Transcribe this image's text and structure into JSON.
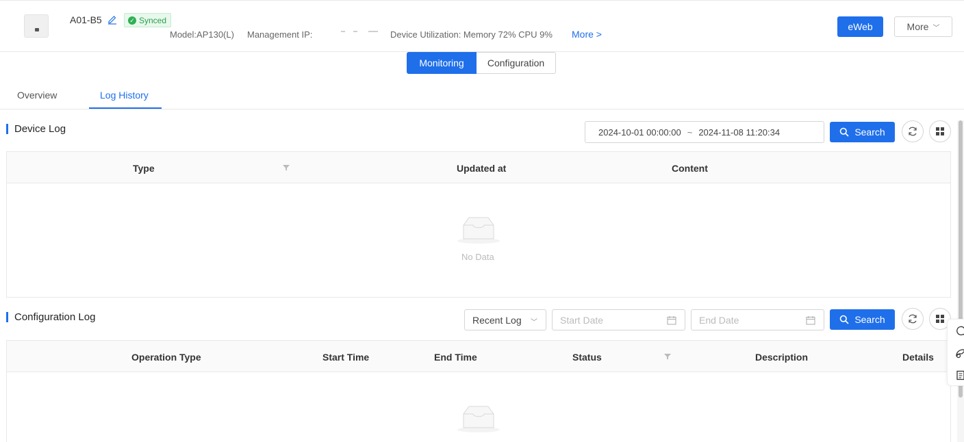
{
  "device": {
    "name": "A01-B5",
    "status": "Synced",
    "model": "Model:AP130(L)",
    "mgmt_ip_label": "Management IP:",
    "utilization": "Device Utilization: Memory 72% CPU 9%",
    "more_link": "More >"
  },
  "actions": {
    "eweb": "eWeb",
    "more": "More"
  },
  "view_switch": {
    "monitoring": "Monitoring",
    "configuration": "Configuration"
  },
  "tabs": {
    "overview": "Overview",
    "log_history": "Log History"
  },
  "device_log": {
    "title": "Device Log",
    "start": "2024-10-01 00:00:00",
    "separator": "~",
    "end": "2024-11-08 11:20:34",
    "search": "Search",
    "columns": [
      "Type",
      "Updated at",
      "Content"
    ],
    "empty": "No Data"
  },
  "config_log": {
    "title": "Configuration Log",
    "range_select": "Recent Log",
    "start_placeholder": "Start Date",
    "end_placeholder": "End Date",
    "search": "Search",
    "columns": [
      "Operation Type",
      "Start Time",
      "End Time",
      "Status",
      "Description",
      "Details"
    ]
  },
  "colors": {
    "accent": "#1f6fea",
    "success": "#2fb053"
  }
}
